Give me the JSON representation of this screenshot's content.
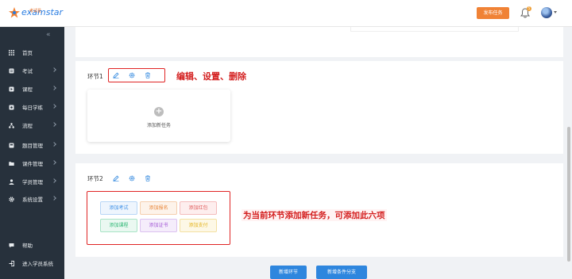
{
  "header": {
    "logo_text": "examstar",
    "logo_sub": "考试星",
    "publish_label": "发布任务",
    "notification_count": "5"
  },
  "sidebar": {
    "collapse_glyph": "«",
    "items": [
      {
        "label": "首页",
        "icon": "grid-icon",
        "arrow": false
      },
      {
        "label": "考试",
        "icon": "exam-icon",
        "arrow": true
      },
      {
        "label": "课程",
        "icon": "course-icon",
        "arrow": true
      },
      {
        "label": "每日学练",
        "icon": "practice-icon",
        "arrow": true
      },
      {
        "label": "流程",
        "icon": "flow-icon",
        "arrow": true
      },
      {
        "label": "题目管理",
        "icon": "question-icon",
        "arrow": true
      },
      {
        "label": "课件管理",
        "icon": "folder-icon",
        "arrow": true
      },
      {
        "label": "学员管理",
        "icon": "user-icon",
        "arrow": true
      },
      {
        "label": "系统设置",
        "icon": "gear-icon",
        "arrow": true
      }
    ],
    "help_label": "帮助",
    "enter_label": "进入学员系统"
  },
  "stage1": {
    "title": "环节1",
    "annotation": "编辑、设置、删除",
    "add_task_label": "添加新任务"
  },
  "stage2": {
    "title": "环节2",
    "annotation": "为当前环节添加新任务，可添加此六项",
    "tasks": [
      {
        "label": "添加考试",
        "color": "#3a8ee6",
        "bg": "#eef5fd"
      },
      {
        "label": "添加报名",
        "color": "#e8873a",
        "bg": "#fdf3ea"
      },
      {
        "label": "添加红包",
        "color": "#e05a5a",
        "bg": "#fdeeee"
      },
      {
        "label": "添加课程",
        "color": "#2bb673",
        "bg": "#eaf8f1"
      },
      {
        "label": "添加证书",
        "color": "#a45bd6",
        "bg": "#f5edfb"
      },
      {
        "label": "添加支付",
        "color": "#e3b21a",
        "bg": "#fdf8e6"
      }
    ]
  },
  "footer": {
    "new_stage_label": "新增环节",
    "new_branch_label": "新增条件分支"
  },
  "colors": {
    "accent": "#2e86de",
    "publish": "#f08235",
    "annotation": "#d42020",
    "sidebar_bg": "#27313c"
  }
}
